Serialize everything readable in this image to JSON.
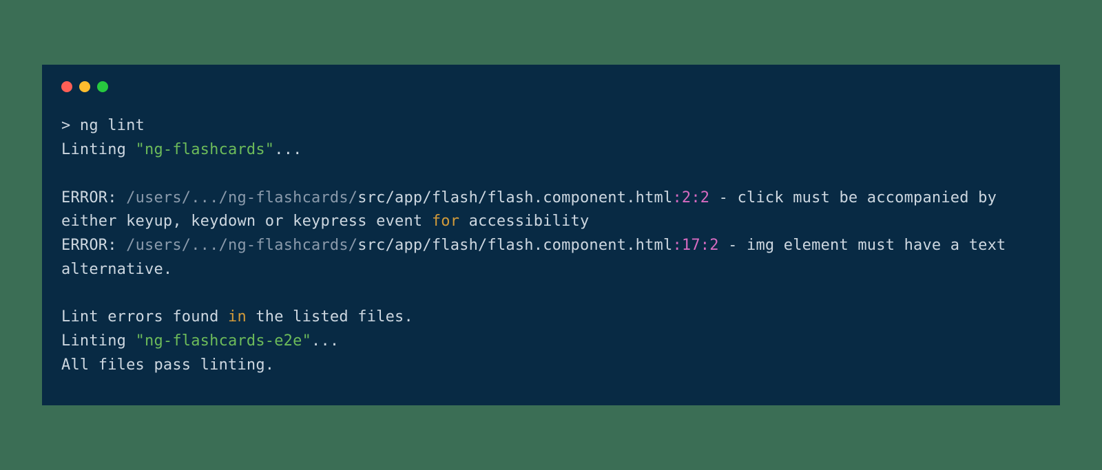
{
  "prompt_symbol": "> ",
  "command": "ng lint",
  "linting_prefix": "Linting ",
  "project1_quoted": "\"ng-flashcards\"",
  "ellipsis": "...",
  "error_label": "ERROR: ",
  "error1": {
    "path_grey": "/users/.../ng-flashcards/",
    "path_mid": "src/app/flash/flash",
    "dot": ".",
    "component": "component",
    "html": "html",
    "loc": ":2:2",
    "dash": " - ",
    "msg_before_for": "click must be accompanied by either keyup, keydown or keypress event ",
    "for": "for",
    "msg_after_for": " accessibility"
  },
  "error2": {
    "path_grey": "/users/.../ng-flashcards/",
    "path_mid": "src/app/flash/flash",
    "dot": ".",
    "component": "component",
    "html": "html",
    "loc": ":17:2",
    "dash": " - ",
    "msg": "img element must have a text alternative."
  },
  "lint_errors_before_in": "Lint errors found ",
  "in": "in",
  "lint_errors_after_in": " the listed files.",
  "project2_quoted": "\"ng-flashcards-e2e\"",
  "pass_line": "All files pass linting."
}
